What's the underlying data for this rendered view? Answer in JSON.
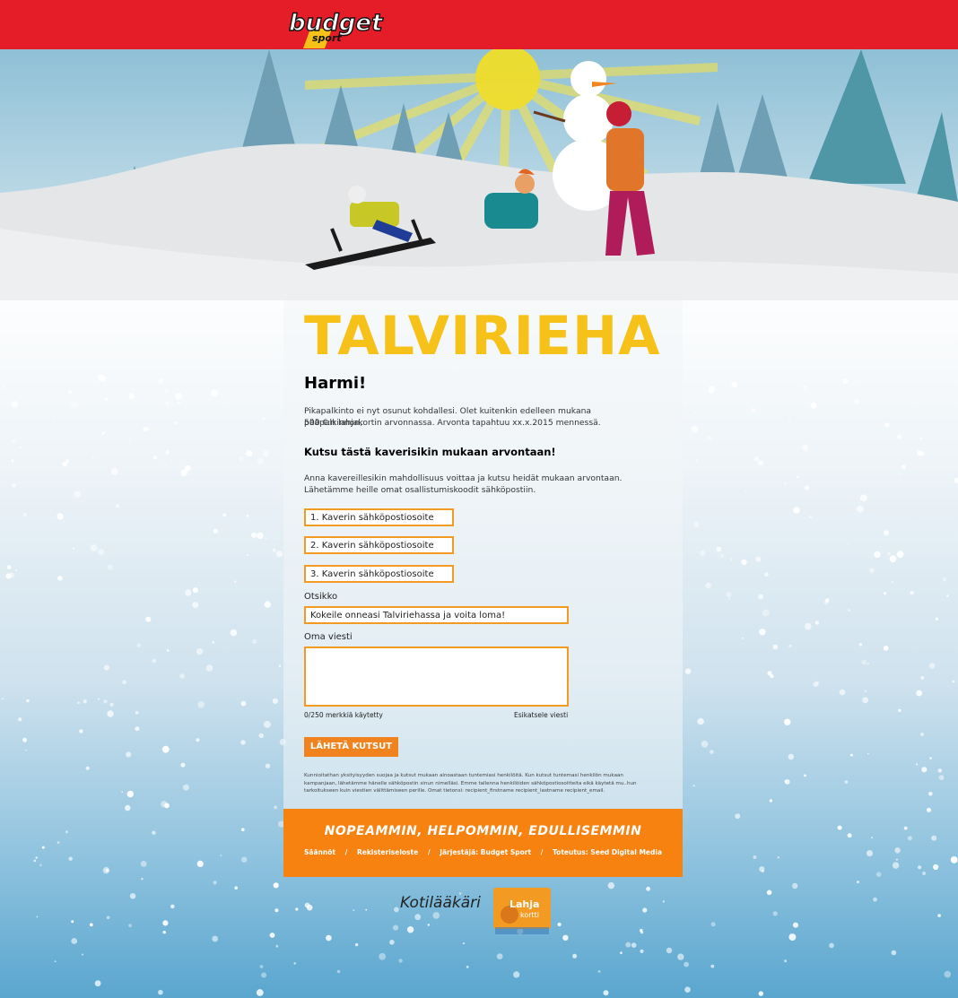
{
  "header": {
    "logo_text": "budget",
    "logo_subtext": "sport"
  },
  "page": {
    "title": "TALVIRIEHA",
    "heading": "Harmi!",
    "result_text_1": "Pikapalkinto ei nyt osunut kohdallesi. Olet kuitenkin edelleen mukana pääpalkinnon,",
    "result_text_2": "500 €:n lahjakortin arvonnassa. Arvonta tapahtuu xx.x.2015 mennessä.",
    "invite_heading": "Kutsu tästä kaverisikin mukaan arvontaan!",
    "invite_text_1": "Anna kavereillesikin mahdollisuus voittaa ja kutsu heidät mukaan arvontaan.",
    "invite_text_2": "Lähetämme heille omat osallistumiskoodit sähköpostiin."
  },
  "form": {
    "email1_placeholder": "1. Kaverin sähköpostiosoite",
    "email2_placeholder": "2. Kaverin sähköpostiosoite",
    "email3_placeholder": "3. Kaverin sähköpostiosoite",
    "subject_label": "Otsikko",
    "subject_value": "Kokeile onneasi Talviriehassa ja voita loma!",
    "message_label": "Oma viesti",
    "char_count": "0/250 merkkiä käytetty",
    "preview_link": "Esikatsele viesti",
    "submit_label": "LÄHETÄ KUTSUT",
    "legal_text": "Kunnioitathan yksityisyyden suojaa ja kutsut mukaan ainoastaan tuntemiasi henkilöitä. Kun kutsut tuntemasi henkilön mukaan kampanjaan, lähetämme hänelle sähköpostin sinun nimelläsi. Emme tallenna henkilöiden sähköpostiosoitteita eikä käytetä mu..hun tarkoitukseen kuin viestien välittämiseen perille. Omat tietonsi: recipient_firstname recipient_lastname recipient_email."
  },
  "footer": {
    "slogan": "NOPEAMMIN, HELPOMMIN, EDULLISEMMIN",
    "links": [
      "Säännöt",
      "Rekisteriseloste",
      "Järjestäjä: Budget Sport",
      "Toteutus: Seed Digital Media"
    ],
    "separator": "/"
  },
  "partners": {
    "kotilaakari": "Kotilääkäri",
    "lahjakortti_line1": "Lahja",
    "lahjakortti_line2": "kortti"
  },
  "colors": {
    "topbar": "#e51d28",
    "title": "#f6c219",
    "accent": "#f39a22",
    "footer": "#f7820f"
  }
}
